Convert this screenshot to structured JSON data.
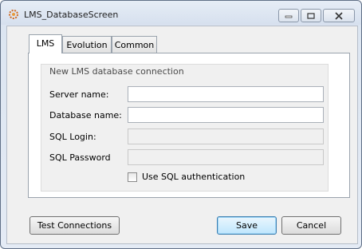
{
  "window": {
    "title": "LMS_DatabaseScreen"
  },
  "tabs": [
    {
      "label": "LMS"
    },
    {
      "label": "Evolution"
    },
    {
      "label": "Common"
    }
  ],
  "group": {
    "title": "New LMS database connection",
    "server_label": "Server name:",
    "server_value": "",
    "database_label": "Database name:",
    "database_value": "",
    "login_label": "SQL Login:",
    "login_value": "",
    "password_label": "SQL Password",
    "password_value": "",
    "sql_auth_label": "Use SQL authentication",
    "sql_auth_checked": false
  },
  "buttons": {
    "test": "Test Connections",
    "save": "Save",
    "cancel": "Cancel"
  },
  "icons": {
    "app": "app-gear-icon",
    "minimize": "minimize-icon",
    "maximize": "maximize-icon",
    "close": "close-icon"
  },
  "colors": {
    "default_button_border": "#3c7fb1",
    "close_button": "#c75050"
  }
}
